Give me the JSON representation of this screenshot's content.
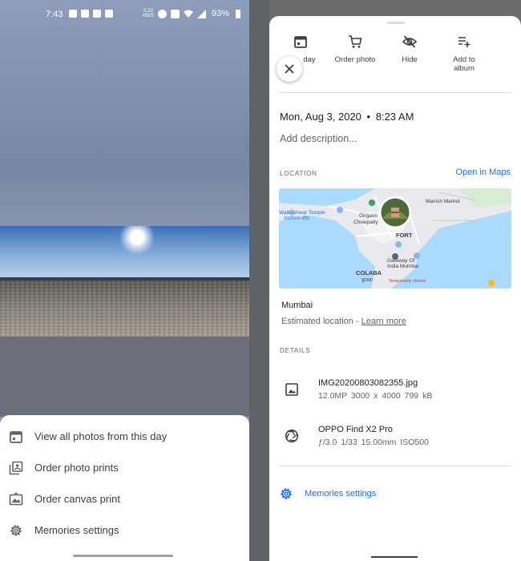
{
  "status_bar": {
    "time": "7:43",
    "speed_value": "0.23",
    "speed_unit": "KB/S",
    "battery": "93%"
  },
  "left_sheet": {
    "items": [
      {
        "label": "View all photos from this day",
        "icon": "calendar-icon"
      },
      {
        "label": "Order photo prints",
        "icon": "photo-prints-icon"
      },
      {
        "label": "Order canvas print",
        "icon": "canvas-print-icon"
      },
      {
        "label": "Memories settings",
        "icon": "gear-icon"
      }
    ]
  },
  "actions": [
    {
      "label": "day",
      "icon": "calendar-icon"
    },
    {
      "label": "Order photo",
      "icon": "cart-icon"
    },
    {
      "label": "Hide",
      "icon": "hide-icon"
    },
    {
      "label": "Add to album",
      "icon": "add-to-playlist-icon"
    }
  ],
  "info": {
    "date": "Mon, Aug 3, 2020",
    "separator": "•",
    "time": "8:23 AM",
    "description_placeholder": "Add description..."
  },
  "location": {
    "section_label": "LOCATION",
    "open_maps": "Open in Maps",
    "map_labels": {
      "walkeshwar": "Walkeshwar Temple",
      "walkeshwar_local": "वाळकेश्वर मंदिर",
      "girgaon": "Girgaon",
      "chowpatty": "Chowpatty",
      "manish": "Manish Market",
      "fort": "FORT",
      "gateway1": "Gateway Of",
      "gateway2": "India Mumbai",
      "colaba": "COLABA",
      "colaba_local": "कुलाबा",
      "temp_closed": "Temporarily closed"
    },
    "place": "Mumbai",
    "estimated": "Estimated location - ",
    "learn_more": "Learn more"
  },
  "details": {
    "section_label": "DETAILS",
    "file": {
      "name": "IMG20200803082355.jpg",
      "meta": "12.0MP   3000 x 4000   799 kB"
    },
    "camera": {
      "name": "OPPO Find X2 Pro",
      "meta": "ƒ/3.0   1/33   15.00mm   ISO500"
    }
  },
  "memories_settings": "Memories settings",
  "colors": {
    "accent": "#1a73e8",
    "map_water": "#aadaff",
    "map_land": "#e8eaed"
  }
}
